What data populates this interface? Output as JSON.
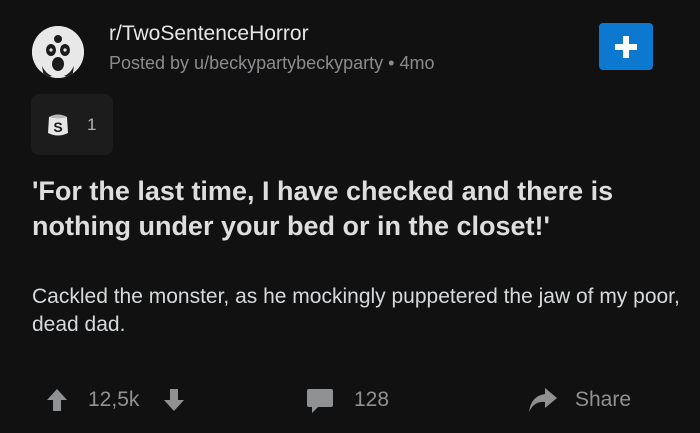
{
  "header": {
    "subreddit": "r/TwoSentenceHorror",
    "posted_by": "Posted by u/beckypartybeckyparty",
    "separator": "•",
    "age": "4mo",
    "join_icon": "plus-icon",
    "join_color": "#0b79d0"
  },
  "awards": {
    "icon": "silver-award-icon",
    "count": "1"
  },
  "post": {
    "title": "'For the last time, I have checked and there is nothing under your bed or in the closet!'",
    "body": "Cackled the monster, as he mockingly puppetered the jaw of my poor, dead dad."
  },
  "actions": {
    "score": "12,5k",
    "comments": "128",
    "share_label": "Share",
    "upvote_icon": "arrow-up-icon",
    "downvote_icon": "arrow-down-icon",
    "comment_icon": "comment-icon",
    "share_icon": "share-icon"
  },
  "colors": {
    "background": "#111111",
    "accent": "#0b79d0",
    "muted": "#8f9193"
  }
}
